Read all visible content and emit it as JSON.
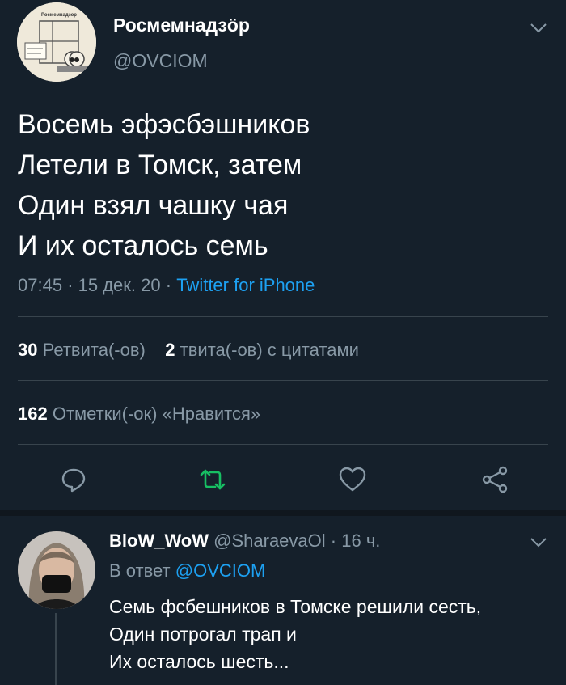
{
  "tweet": {
    "author_name": "Росмемнадзöр",
    "author_handle": "@OVCIOM",
    "avatar_text": "Росмемнадзор",
    "text_lines": [
      "Восемь эфэсбэшников",
      "Летели в Томск, затем",
      "Один взял чашку чая",
      "И их осталось семь"
    ],
    "time": "07:45",
    "date": "15 дек. 20",
    "separator": "·",
    "source": "Twitter for iPhone",
    "retweets_count": "30",
    "retweets_label": "Ретвита(-ов)",
    "quotes_count": "2",
    "quotes_label": "твита(-ов) с цитатами",
    "likes_count": "162",
    "likes_label": "Отметки(-ок) «Нравится»",
    "retweet_icon_color": "#17bf63"
  },
  "reply": {
    "author_name": "BloW_WoW",
    "author_handle": "@SharaevaOl",
    "time_ago": "16 ч.",
    "separator": "·",
    "reply_to_label": "В ответ",
    "reply_to_mention": "@OVCIOM",
    "text_lines": [
      "Семь фсбешников в Томске решили сесть,",
      "Один потрогал трап и",
      "Их осталось шесть..."
    ]
  },
  "colors": {
    "background": "#15202b",
    "text_secondary": "#8899a6",
    "accent": "#1da1f2",
    "divider": "#38444d"
  }
}
